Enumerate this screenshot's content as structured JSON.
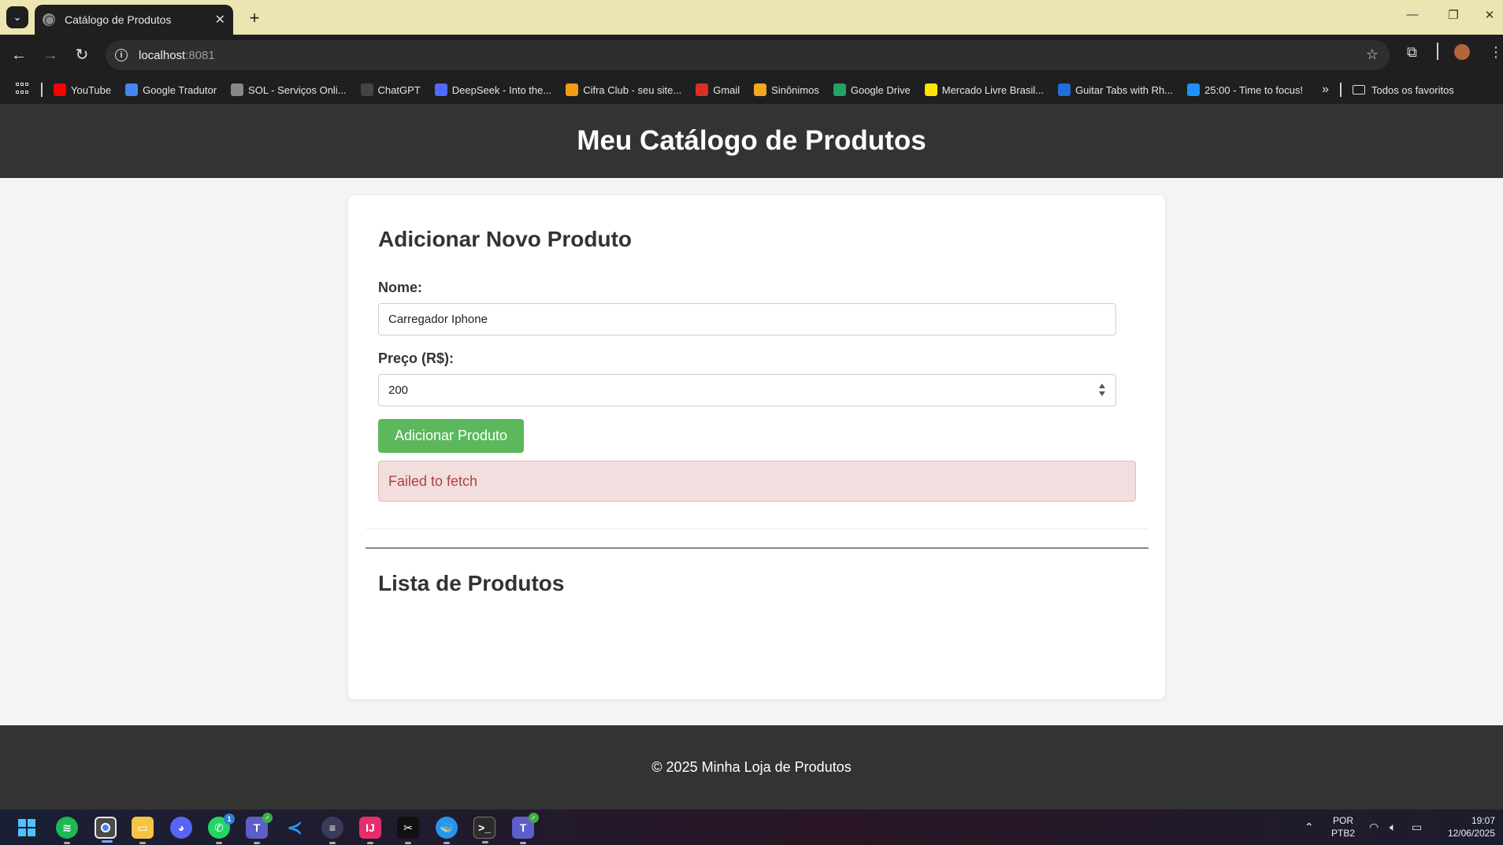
{
  "browser": {
    "tab_title": "Catálogo de Produtos",
    "url_host": "localhost",
    "url_port": ":8081",
    "bookmarks": [
      {
        "label": "YouTube",
        "icon": "youtube-icon",
        "color": "#ff0000"
      },
      {
        "label": "Google Tradutor",
        "icon": "google-translate-icon",
        "color": "#4285f4"
      },
      {
        "label": "SOL - Serviços Onli...",
        "icon": "globe-icon",
        "color": "#888888"
      },
      {
        "label": "ChatGPT",
        "icon": "chatgpt-icon",
        "color": "#444444"
      },
      {
        "label": "DeepSeek - Into the...",
        "icon": "deepseek-icon",
        "color": "#4d6bfe"
      },
      {
        "label": "Cifra Club - seu site...",
        "icon": "cifra-club-icon",
        "color": "#f39c12"
      },
      {
        "label": "Gmail",
        "icon": "gmail-icon",
        "color": "#d93025"
      },
      {
        "label": "Sinônimos",
        "icon": "sinonimos-icon",
        "color": "#f5a623"
      },
      {
        "label": "Google Drive",
        "icon": "google-drive-icon",
        "color": "#1fa463"
      },
      {
        "label": "Mercado Livre Brasil...",
        "icon": "mercado-livre-icon",
        "color": "#ffe600"
      },
      {
        "label": "Guitar Tabs with Rh...",
        "icon": "guitar-tabs-icon",
        "color": "#1e6fd9"
      },
      {
        "label": "25:00 - Time to focus!",
        "icon": "focus-check-icon",
        "color": "#1e90ff"
      }
    ],
    "all_bookmarks_label": "Todos os favoritos"
  },
  "page": {
    "header_title": "Meu Catálogo de Produtos",
    "add_section_title": "Adicionar Novo Produto",
    "name_label": "Nome:",
    "name_value": "Carregador Iphone",
    "price_label": "Preço (R$):",
    "price_value": "200",
    "add_button": "Adicionar Produto",
    "error_message": "Failed to fetch",
    "list_section_title": "Lista de Produtos",
    "footer_text": "© 2025 Minha Loja de Produtos"
  },
  "colors": {
    "header_bg": "#333333",
    "button_green": "#5cb85c",
    "error_bg": "#f2dede",
    "error_text": "#a94442"
  },
  "taskbar": {
    "apps": [
      "windows-start-icon",
      "spotify-icon",
      "chrome-icon",
      "file-explorer-icon",
      "discord-icon",
      "whatsapp-icon",
      "teams-icon",
      "vscode-icon",
      "app-icon",
      "intellij-icon",
      "capcut-icon",
      "docker-icon",
      "terminal-icon",
      "teams-icon"
    ],
    "whatsapp_badge": "1",
    "lang_top": "POR",
    "lang_bottom": "PTB2",
    "time": "19:07",
    "date": "12/06/2025"
  }
}
